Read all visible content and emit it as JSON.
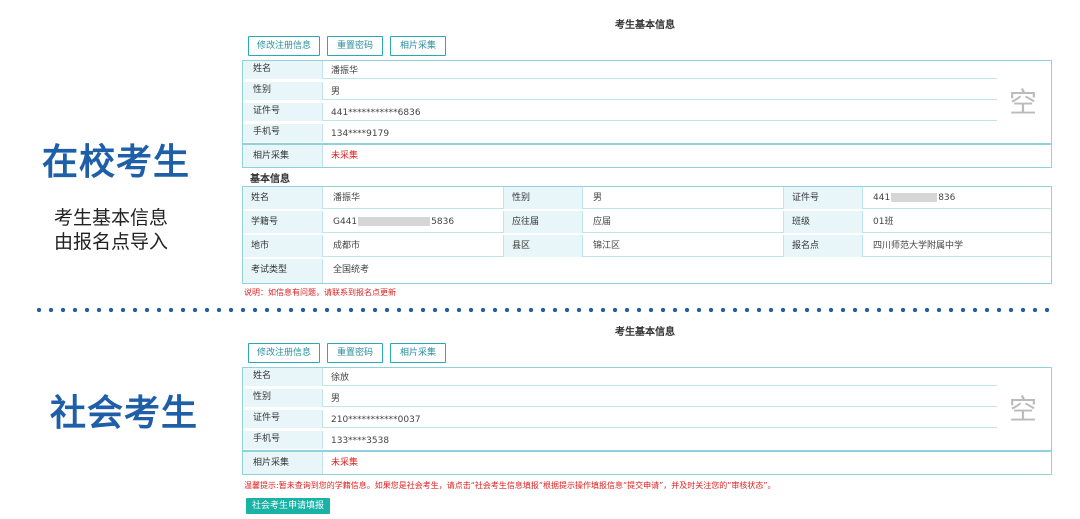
{
  "side": {
    "school_title": "在校考生",
    "school_sub_line1": "考生基本信息",
    "school_sub_line2": "由报名点导入",
    "social_title": "社会考生"
  },
  "panel_title": "考生基本信息",
  "buttons": {
    "edit_registration": "修改注册信息",
    "reset_password": "重置密码",
    "photo_capture": "相片采集"
  },
  "labels": {
    "name": "姓名",
    "gender": "性别",
    "id_number": "证件号",
    "phone": "手机号",
    "photo": "相片采集",
    "photo_placeholder": "空"
  },
  "school_student": {
    "name": "潘振华",
    "gender": "男",
    "id_number": "441***********6836",
    "phone": "134****9179",
    "photo_status": "未采集",
    "basic_info_label": "基本信息",
    "grid": {
      "name_label": "姓名",
      "name": "潘振华",
      "gender_label": "性别",
      "gender": "男",
      "id_label": "证件号",
      "id_prefix": "441",
      "id_suffix": "836",
      "student_no_label": "学籍号",
      "student_no_prefix": "G441",
      "student_no_suffix": "5836",
      "graduate_label": "应往届",
      "graduate": "应届",
      "class_label": "班级",
      "class": "01班",
      "city_label": "地市",
      "city": "成都市",
      "district_label": "县区",
      "district": "锦江区",
      "site_label": "报名点",
      "site": "四川师范大学附属中学",
      "exam_type_label": "考试类型",
      "exam_type": "全国统考"
    },
    "note": "说明：如信息有问题，请联系到报名点更新"
  },
  "social_student": {
    "name": "徐放",
    "gender": "男",
    "id_number": "210***********0037",
    "phone": "133****3538",
    "photo_status": "未采集",
    "note": "温馨提示:暂未查询到您的学籍信息。如果您是社会考生，请点击“社会考生信息填报”根据提示操作填报信息“提交申请”，并及时关注您的“审核状态”。",
    "apply_button": "社会考生申请填报"
  }
}
